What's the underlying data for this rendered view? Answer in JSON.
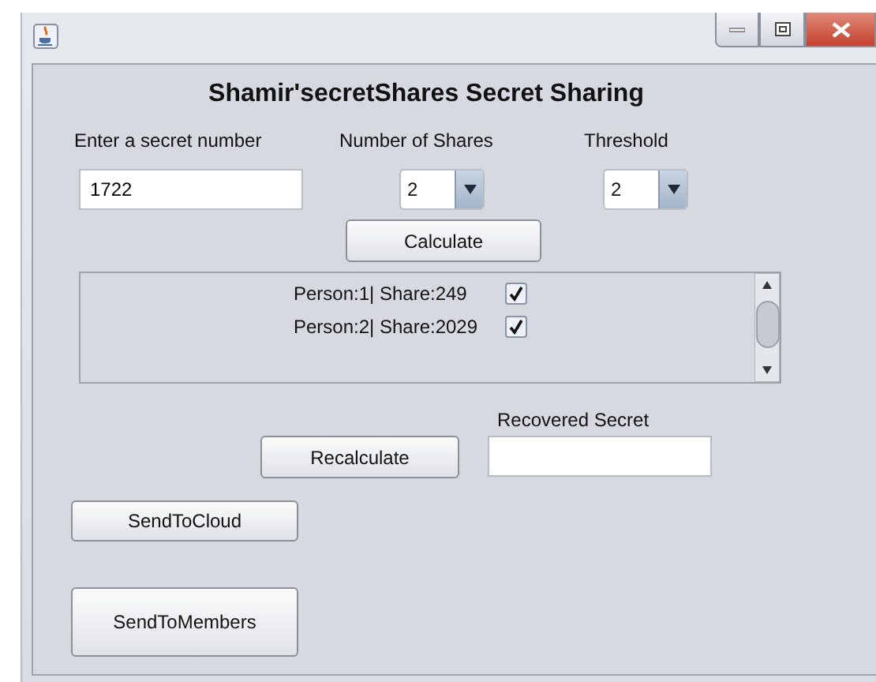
{
  "heading": "Shamir'secretShares Secret Sharing",
  "secret": {
    "label": "Enter a secret number",
    "value": "1722"
  },
  "shares": {
    "label": "Number of Shares",
    "value": "2"
  },
  "threshold": {
    "label": "Threshold",
    "value": "2"
  },
  "calculate_button": "Calculate",
  "share_list": [
    {
      "text": "Person:1| Share:249",
      "checked": true
    },
    {
      "text": "Person:2| Share:2029",
      "checked": true
    }
  ],
  "recalculate_button": "Recalculate",
  "recovered": {
    "label": "Recovered Secret"
  },
  "send_to_cloud_button": "SendToCloud",
  "send_to_members_button": "SendToMembers"
}
